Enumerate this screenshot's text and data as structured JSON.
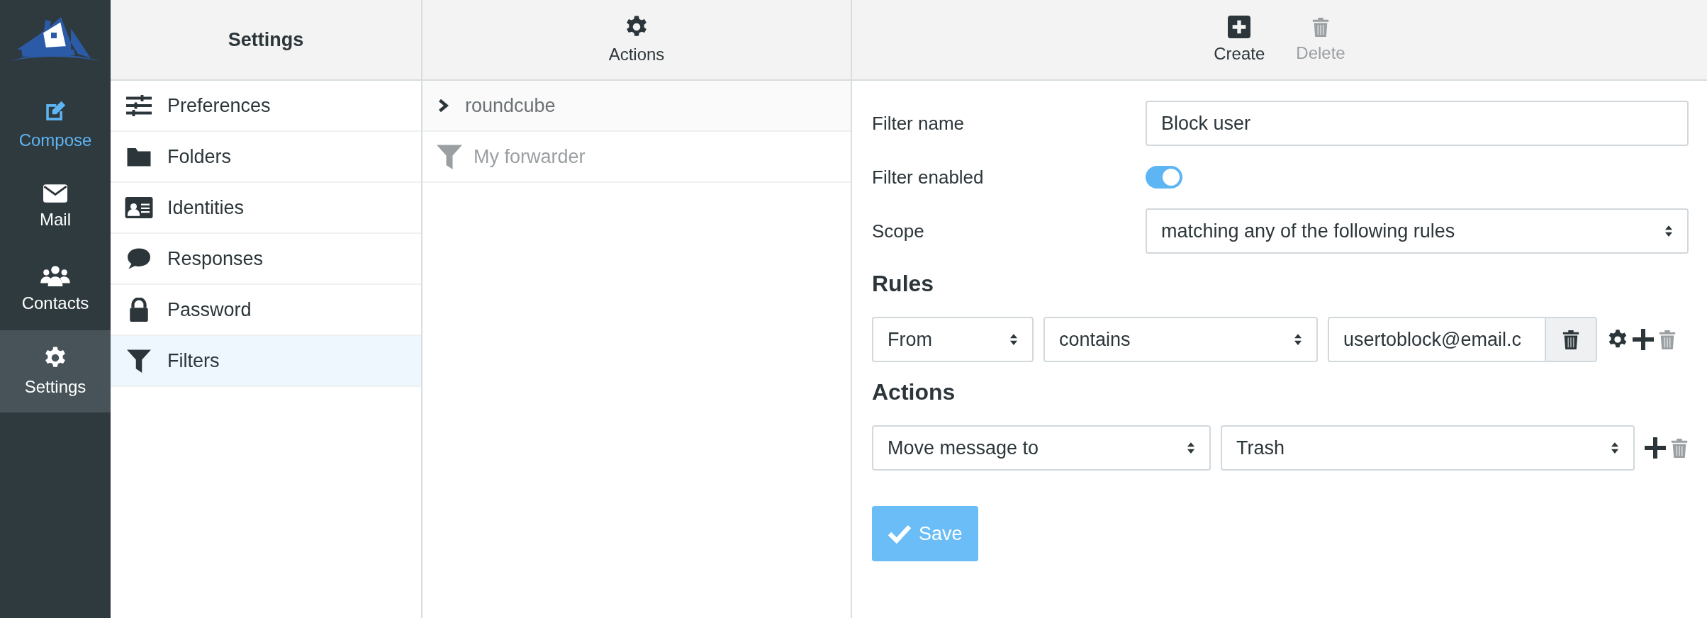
{
  "nav": [
    {
      "label": "Compose",
      "kind": "compose",
      "selected": false
    },
    {
      "label": "Mail",
      "kind": "mail",
      "selected": false
    },
    {
      "label": "Contacts",
      "kind": "contacts",
      "selected": false
    },
    {
      "label": "Settings",
      "kind": "settings",
      "selected": true
    }
  ],
  "settings": {
    "title": "Settings",
    "items": [
      {
        "label": "Preferences",
        "kind": "preferences",
        "selected": false
      },
      {
        "label": "Folders",
        "kind": "folders",
        "selected": false
      },
      {
        "label": "Identities",
        "kind": "identities",
        "selected": false
      },
      {
        "label": "Responses",
        "kind": "responses",
        "selected": false
      },
      {
        "label": "Password",
        "kind": "password",
        "selected": false
      },
      {
        "label": "Filters",
        "kind": "filters",
        "selected": true
      }
    ]
  },
  "filters": {
    "actions_label": "Actions",
    "items": [
      {
        "label": "roundcube",
        "kind": "set",
        "expanded": false,
        "disabled": false
      },
      {
        "label": "My forwarder",
        "kind": "filter",
        "disabled": true
      }
    ]
  },
  "toolbar": [
    {
      "label": "Create",
      "kind": "create",
      "disabled": false
    },
    {
      "label": "Delete",
      "kind": "delete",
      "disabled": true
    }
  ],
  "form": {
    "name_label": "Filter name",
    "name_value": "Block user",
    "enabled_label": "Filter enabled",
    "enabled": true,
    "scope_label": "Scope",
    "scope_value": "matching any of the following rules",
    "rules_heading": "Rules",
    "rules": [
      {
        "header": "From",
        "operator": "contains",
        "value": "usertoblock@email.c"
      }
    ],
    "actions_heading": "Actions",
    "actions": [
      {
        "action": "Move message to",
        "target": "Trash"
      }
    ],
    "save_label": "Save"
  }
}
